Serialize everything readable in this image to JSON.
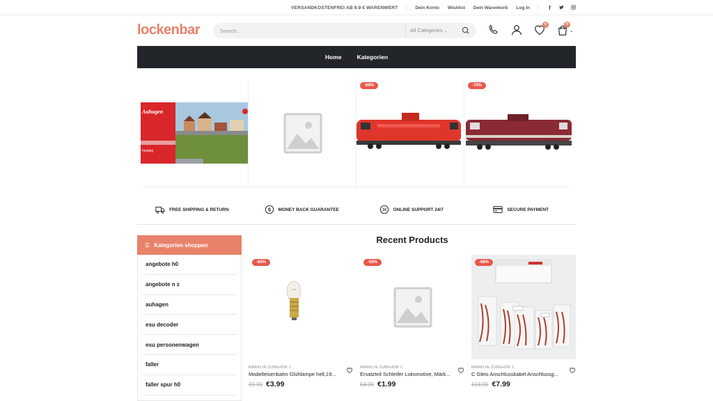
{
  "topbar": {
    "shipping_note": "VERSANDKOSTENFREI AB 9.9 € WARENWERT",
    "links": [
      "Dein Konto",
      "Wishlist",
      "Dein Warenkorb",
      "Log In"
    ],
    "social": [
      "facebook-icon",
      "twitter-icon",
      "instagram-icon"
    ]
  },
  "header": {
    "logo": "lockenbar",
    "search_placeholder": "Search...",
    "category_select": "All Categories",
    "wishlist_count": "0",
    "cart_count": "0"
  },
  "nav": {
    "items": [
      "Home",
      "Kategorien"
    ]
  },
  "hero": {
    "items": [
      {
        "discount": "",
        "image": "auhagen-box"
      },
      {
        "discount": "",
        "image": "placeholder"
      },
      {
        "discount": "-69%",
        "image": "red-locomotive"
      },
      {
        "discount": "-70%",
        "image": "dark-red-locomotive"
      }
    ]
  },
  "features": [
    {
      "icon": "truck-icon",
      "label": "FREE SHIPPING & RETURN"
    },
    {
      "icon": "dollar-icon",
      "label": "MONEY BACK GUARANTEE"
    },
    {
      "icon": "support-24-icon",
      "label": "ONLINE SUPPORT 24/7"
    },
    {
      "icon": "card-icon",
      "label": "SECURE PAYMENT"
    }
  ],
  "sidebar": {
    "title": "Kategorien shoppen",
    "items": [
      "angebote h0",
      "angebote n z",
      "auhagen",
      "esu decoder",
      "esu personenwagen",
      "faller",
      "faller spur h0"
    ]
  },
  "recent": {
    "title": "Recent Products",
    "products": [
      {
        "discount": "-60%",
        "category": "MÄRKLIN ZUBEHÖR 1",
        "name": "Modelleisenbahn Glühlampe hell,19...",
        "old_price": "€9.90",
        "price": "€3.99",
        "image": "bulb"
      },
      {
        "discount": "-59%",
        "category": "MÄRKLIN ZUBEHÖR 1",
        "name": "Ersatzteil Schleifer Lokomotive, Märk...",
        "old_price": "€4.90",
        "price": "€1.99",
        "image": "placeholder"
      },
      {
        "discount": "-68%",
        "category": "MÄRKLIN ZUBEHÖR 1",
        "name": "C Gleis Anschlusskabel Anschlussg...",
        "old_price": "€24.90",
        "price": "€7.99",
        "image": "cables"
      }
    ]
  },
  "colors": {
    "accent": "#e9826a",
    "nav_bg": "#222529",
    "discount": "#e9574b"
  }
}
